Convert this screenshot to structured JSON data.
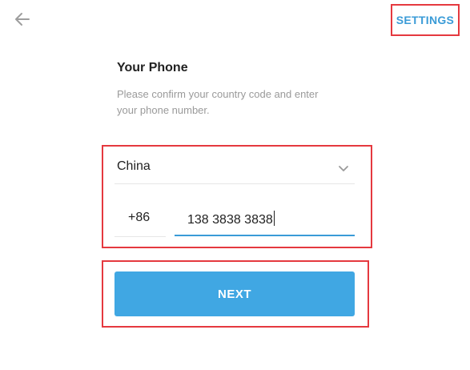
{
  "header": {
    "back_icon": "arrow-left-icon",
    "settings_label": "SETTINGS"
  },
  "main": {
    "title": "Your Phone",
    "description": "Please confirm your country code and enter your phone number.",
    "country": {
      "selected": "China",
      "icon": "chevron-down-icon"
    },
    "country_code": "+86",
    "phone_number": "138 3838 3838",
    "next_label": "NEXT"
  },
  "colors": {
    "accent": "#3a9bd7",
    "button": "#40a7e3",
    "highlight_box": "#e5393f"
  }
}
